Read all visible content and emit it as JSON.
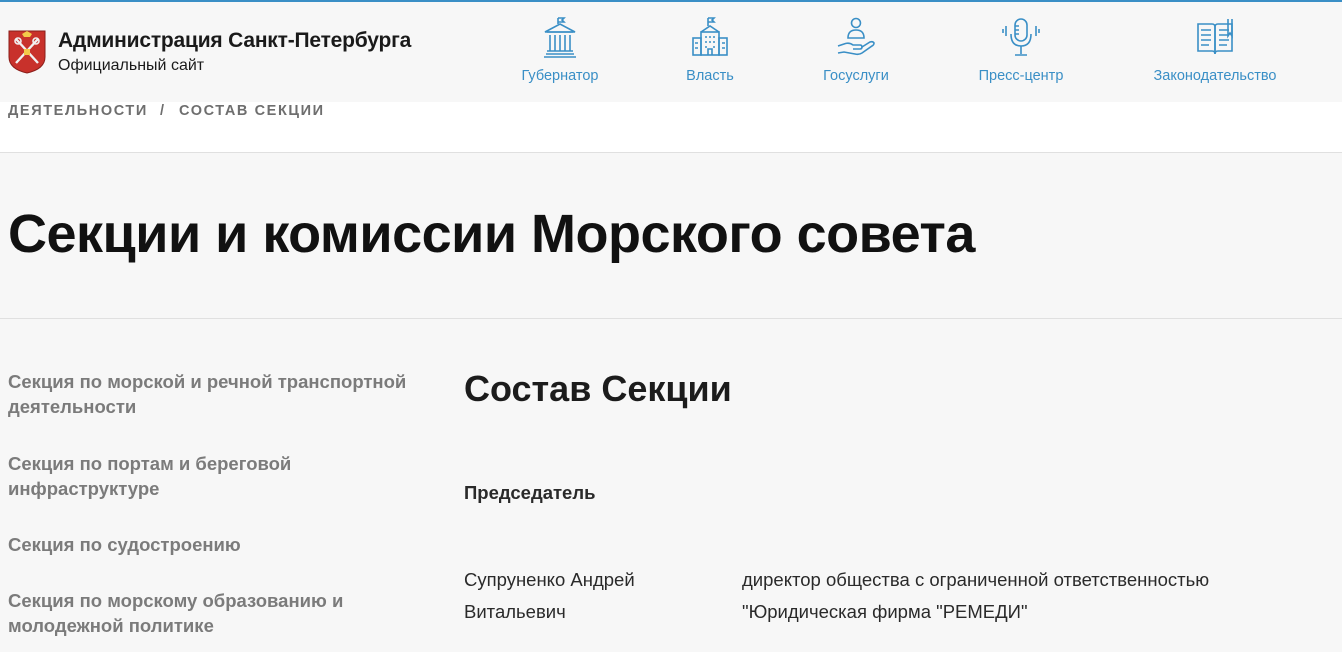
{
  "header": {
    "title": "Администрация Санкт-Петербурга",
    "subtitle": "Официальный сайт",
    "nav": [
      {
        "label": "Губернатор",
        "icon": "government-building-icon"
      },
      {
        "label": "Власть",
        "icon": "office-building-flag-icon"
      },
      {
        "label": "Госуслуги",
        "icon": "hand-person-icon"
      },
      {
        "label": "Пресс-центр",
        "icon": "microphone-icon"
      },
      {
        "label": "Законодательство",
        "icon": "open-book-icon"
      }
    ],
    "accent_color": "#3a8fc6"
  },
  "breadcrumbs": {
    "items": [
      "ДЕЯТЕЛЬНОСТИ",
      "СОСТАВ СЕКЦИИ"
    ],
    "separator": "/"
  },
  "page": {
    "title": "Секции и комиссии Морского совета"
  },
  "sidebar": {
    "items": [
      {
        "label": "Секция по морской и речной транспортной деятельности"
      },
      {
        "label": "Секция по портам и береговой инфраструктуре"
      },
      {
        "label": "Секция по судостроению"
      },
      {
        "label": "Секция по морскому образованию и молодежной политике"
      }
    ]
  },
  "content": {
    "section_title": "Состав Секции",
    "role": "Председатель",
    "members": [
      {
        "name": "Супруненко Андрей Витальевич",
        "position": "директор общества с ограниченной ответственностью \"Юридическая фирма \"РЕМЕДИ\""
      }
    ]
  }
}
